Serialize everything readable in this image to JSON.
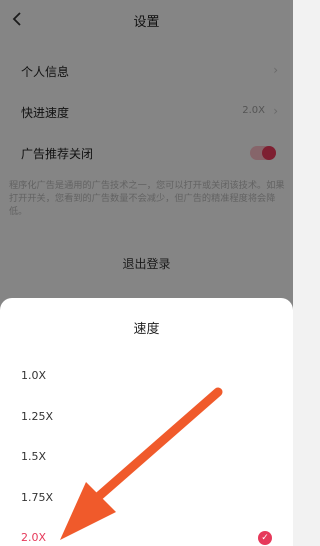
{
  "header": {
    "back_icon": "chevron-left-icon",
    "title": "设置"
  },
  "settings": {
    "items": [
      {
        "label": "个人信息",
        "chevron": "›"
      },
      {
        "label": "快进速度",
        "value": "2.0X",
        "chevron": "›"
      },
      {
        "label": "广告推荐关闭",
        "toggle_on": true
      }
    ],
    "description": "程序化广告是通用的广告技术之一，您可以打开或关闭该技术。如果打开开关，您看到的广告数量不会减少，但广告的精准程度将会降低。",
    "logout_label": "退出登录"
  },
  "speed_sheet": {
    "title": "速度",
    "options": [
      "1.0X",
      "1.25X",
      "1.5X",
      "1.75X",
      "2.0X"
    ],
    "selected": "2.0X",
    "check_icon": "checkmark-icon"
  },
  "colors": {
    "accent": "#e6395a",
    "arrow": "#f05a2b",
    "background": "#f2f2f2"
  }
}
